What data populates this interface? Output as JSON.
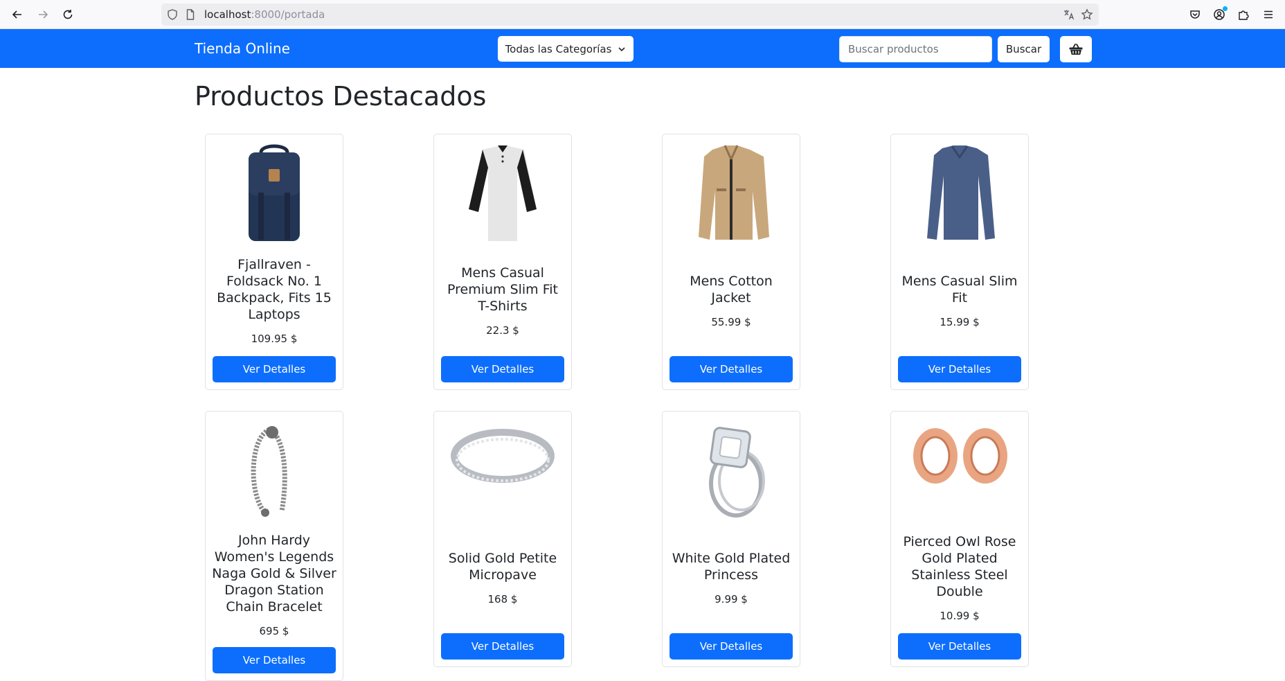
{
  "browser": {
    "url_host": "localhost",
    "url_rest": ":8000/portada"
  },
  "navbar": {
    "brand": "Tienda Online",
    "category_dropdown": "Todas las Categorías",
    "search_placeholder": "Buscar productos",
    "search_button": "Buscar",
    "cart_icon": "basket-icon"
  },
  "page_title": "Productos Destacados",
  "details_label": "Ver Detalles",
  "products": [
    {
      "name": "Fjallraven - Foldsack No. 1 Backpack, Fits 15 Laptops",
      "price": "109.95 $",
      "icon": "backpack-image"
    },
    {
      "name": "Mens Casual Premium Slim Fit T-Shirts",
      "price": "22.3 $",
      "icon": "tshirt-image"
    },
    {
      "name": "Mens Cotton Jacket",
      "price": "55.99 $",
      "icon": "jacket-image"
    },
    {
      "name": "Mens Casual Slim Fit",
      "price": "15.99 $",
      "icon": "sweater-image"
    },
    {
      "name": "John Hardy Women's Legends Naga Gold & Silver Dragon Station Chain Bracelet",
      "price": "695 $",
      "icon": "bracelet-image"
    },
    {
      "name": "Solid Gold Petite Micropave",
      "price": "168 $",
      "icon": "ring-image"
    },
    {
      "name": "White Gold Plated Princess",
      "price": "9.99 $",
      "icon": "diamond-ring-image"
    },
    {
      "name": "Pierced Owl Rose Gold Plated Stainless Steel Double",
      "price": "10.99 $",
      "icon": "tunnel-earrings-image"
    }
  ],
  "colors": {
    "primary": "#0d6efd"
  }
}
